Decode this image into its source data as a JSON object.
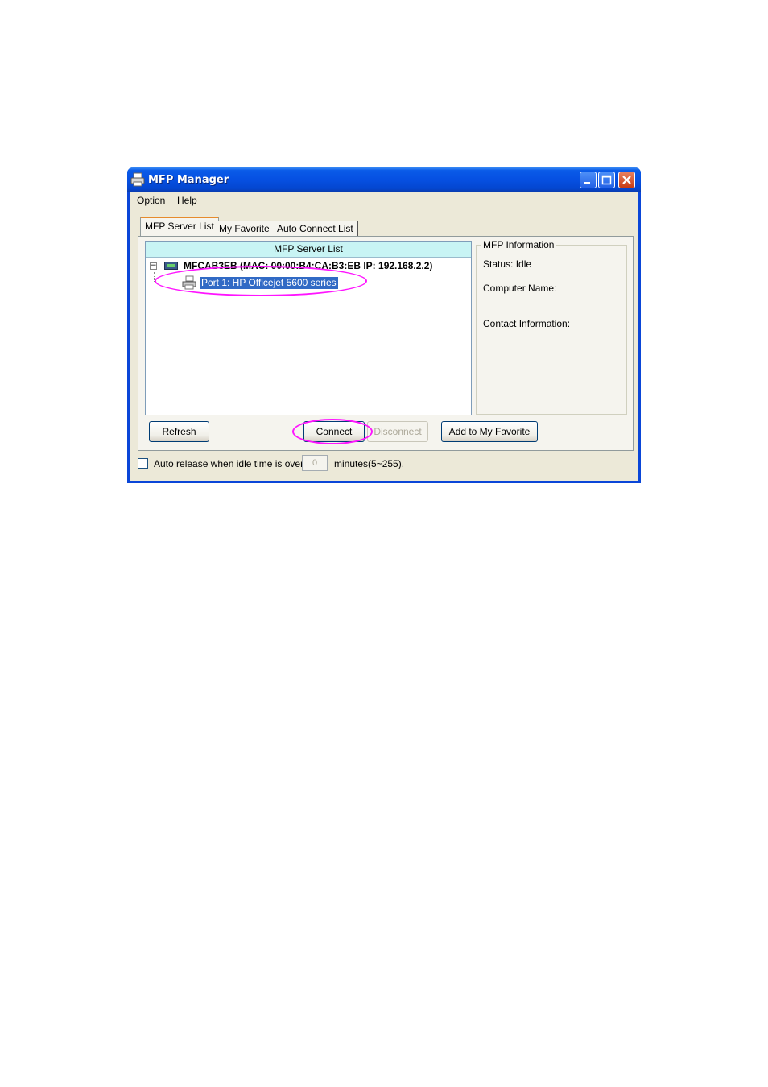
{
  "window": {
    "title": "MFP Manager",
    "icon": "printer-icon",
    "controls": [
      "minimize-icon",
      "maximize-icon",
      "close-icon"
    ]
  },
  "menu": [
    {
      "label": "Option"
    },
    {
      "label": "Help"
    }
  ],
  "tabs": [
    {
      "label": "MFP Server List",
      "active": true
    },
    {
      "label": "My Favorite",
      "active": false
    },
    {
      "label": "Auto Connect List",
      "active": false
    }
  ],
  "server_list": {
    "header": "MFP Server List",
    "root": {
      "label": "MFCAB3EB (MAC: 00:00:B4:CA:B3:EB   IP: 192.168.2.2)",
      "icon": "server-icon",
      "expanded": true
    },
    "child": {
      "label": "Port 1: HP Officejet 5600 series",
      "icon": "printer-icon",
      "selected": true
    }
  },
  "info": {
    "legend": "MFP Information",
    "status": "Status: Idle",
    "computer_name": "Computer Name:",
    "contact": "Contact Information:"
  },
  "buttons": {
    "refresh": "Refresh",
    "connect": "Connect",
    "disconnect": "Disconnect",
    "favorite": "Add to My Favorite"
  },
  "auto_release": {
    "label": "Auto release when idle time is over",
    "value": "0",
    "suffix": "minutes(5~255).",
    "checked": false
  },
  "colors": {
    "titlebar": "#0650e2",
    "selection": "#316ac5",
    "highlight": "#ff14ff",
    "list_header": "#c8f4f4"
  }
}
